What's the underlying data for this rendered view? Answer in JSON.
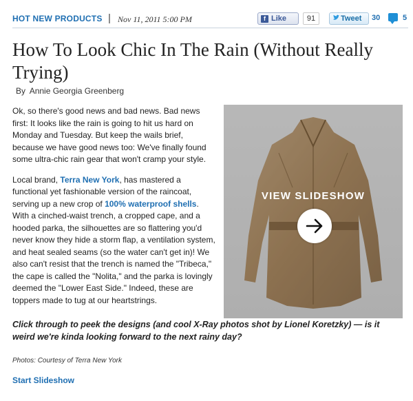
{
  "header": {
    "category": "HOT NEW PRODUCTS",
    "separator": "|",
    "date": "Nov 11, 2011 5:00 PM",
    "like_label": "Like",
    "like_icon_glyph": "f",
    "like_count": "91",
    "tweet_label": "Tweet",
    "tweet_count": "30",
    "comment_count": "5"
  },
  "article": {
    "title": "How To Look Chic In The Rain (Without Really Trying)",
    "byline_label": "By",
    "author": "Annie Georgia Greenberg",
    "p1": "Ok, so there's good news and bad news. Bad news first: It looks like the rain is going to hit us hard on Monday and Tuesday. But keep the wails brief, because we have good news too: We've finally found some ultra-chic rain gear that won't cramp your style.",
    "p2_a": "Local brand, ",
    "p2_link1": "Terra New York",
    "p2_b": ", has mastered a functional yet fashionable version of the raincoat, serving up a new crop of ",
    "p2_link2": "100% waterproof shells",
    "p2_c": ". With a cinched-waist trench, a cropped cape, and a hooded parka, the silhouettes are so flattering you'd never know they hide a storm flap, a ventilation system, and heat sealed seams (so the water can't get in)! We also can't resist that the trench is named the \"Tribeca,\" the cape is called the \"Nolita,\" and the parka is lovingly deemed the \"Lower East Side.\" Indeed, these are toppers made to tug at our heartstrings.",
    "callout": "Click through to peek the designs (and cool X-Ray photos shot by Lionel Koretzky) — is it weird we're kinda looking forward to the next rainy day?",
    "credit": "Photos: Courtesy of Terra New York",
    "start_link": "Start Slideshow"
  },
  "slideshow": {
    "label": "VIEW SLIDESHOW",
    "image_subject": "translucent tan trench coat"
  },
  "colors": {
    "link": "#1f6fb2",
    "coat": "#a27a45"
  }
}
